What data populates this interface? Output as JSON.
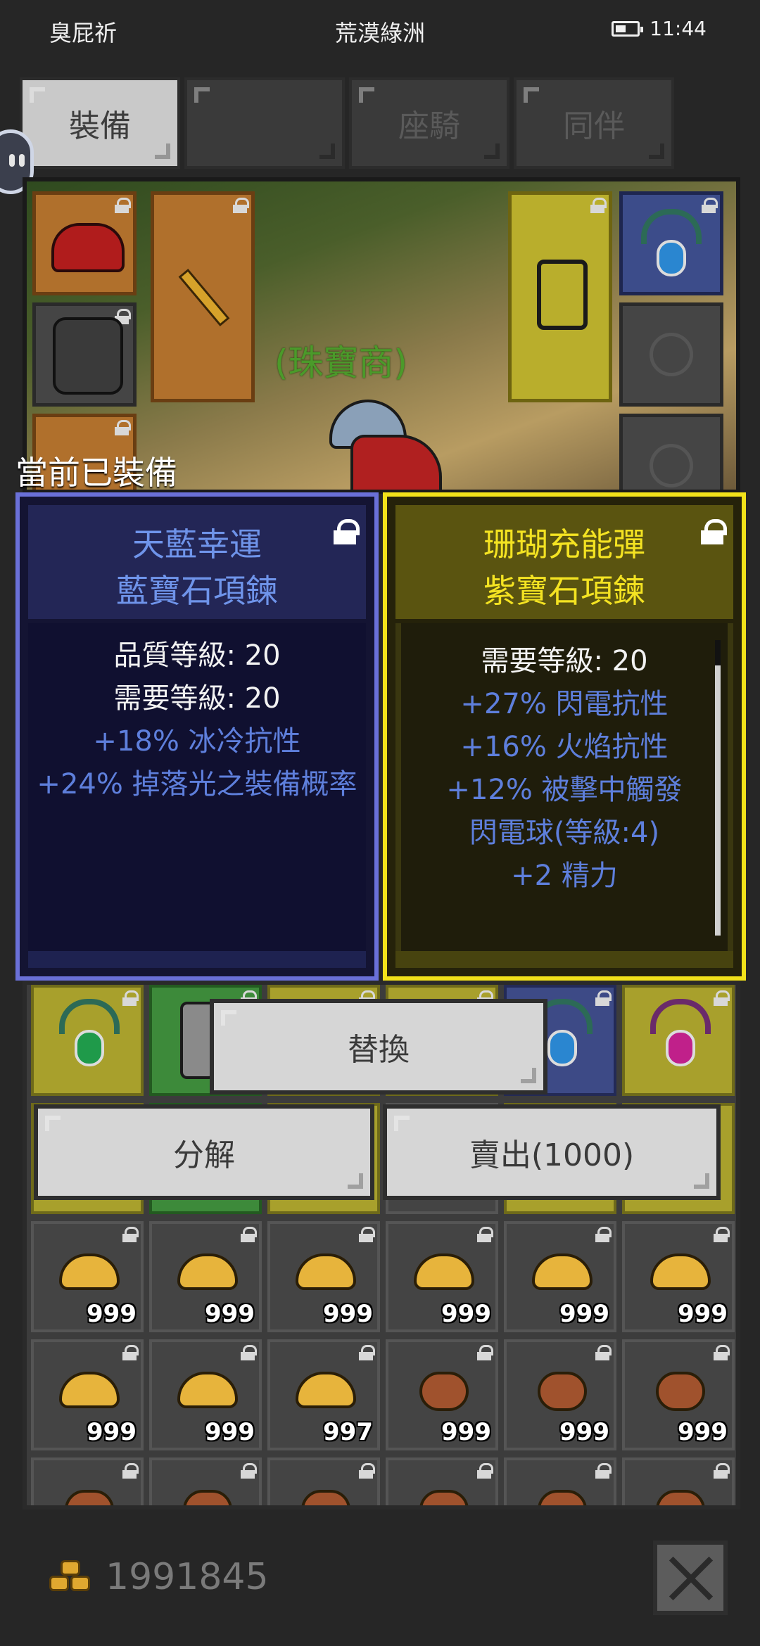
{
  "status_bar": {
    "left_text": "臭屁祈",
    "center_text": "荒漠綠洲",
    "time": "11:44"
  },
  "tabs": [
    {
      "label": "裝備",
      "active": true
    },
    {
      "label": "",
      "active": false
    },
    {
      "label": "座騎",
      "active": false
    },
    {
      "label": "同伴",
      "active": false
    }
  ],
  "scene": {
    "npc_label": "(珠寶商)"
  },
  "equipped_label": "當前已裝備",
  "equipped_item": {
    "name_line1": "天藍幸運",
    "name_line2": "藍寶石項鍊",
    "stats": [
      {
        "text": "品質等級: 20",
        "color": "white"
      },
      {
        "text": "需要等級: 20",
        "color": "white"
      },
      {
        "text": "+18% 冰冷抗性",
        "color": "blue"
      },
      {
        "text": "+24% 掉落光之裝備概率",
        "color": "blue"
      }
    ],
    "border_color": "#6a70d8"
  },
  "selected_item": {
    "name_line1": "珊瑚充能彈",
    "name_line2": "紫寶石項鍊",
    "stats": [
      {
        "text": "需要等級: 20",
        "color": "white"
      },
      {
        "text": "+27% 閃電抗性",
        "color": "blue"
      },
      {
        "text": "+16% 火焰抗性",
        "color": "blue"
      },
      {
        "text": "+12% 被擊中觸發",
        "color": "blue"
      },
      {
        "text": "閃電球(等級:4)",
        "color": "blue"
      },
      {
        "text": "+2 精力",
        "color": "blue"
      }
    ],
    "border_color": "#f2e21a"
  },
  "actions": {
    "replace_label": "替換",
    "dismantle_label": "分解",
    "sell_label": "賣出(1000)"
  },
  "inventory": {
    "row3": [
      "999",
      "999",
      "999",
      "999",
      "999",
      "999"
    ],
    "row4": [
      "999",
      "999",
      "997",
      "999",
      "999",
      "999"
    ]
  },
  "footer": {
    "gold": "1991845",
    "close_icon": "close-icon"
  }
}
